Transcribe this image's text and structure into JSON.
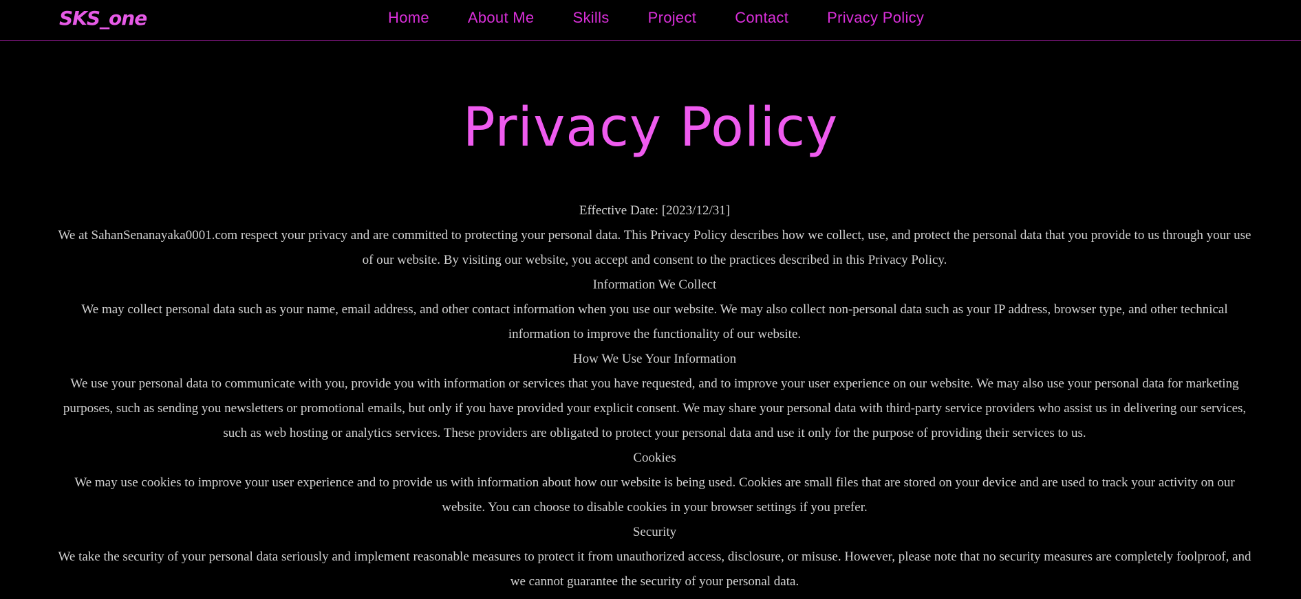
{
  "navbar": {
    "logo": "SKS_one",
    "links": [
      "Home",
      "About Me",
      "Skills",
      "Project",
      "Contact",
      "Privacy Policy"
    ]
  },
  "page_title": "Privacy Policy",
  "policy": {
    "effective_date": "Effective Date: [2023/12/31]",
    "intro": "We at SahanSenanayaka0001.com respect your privacy and are committed to protecting your personal data. This Privacy Policy describes how we collect, use, and protect the personal data that you provide to us through your use of our website. By visiting our website, you accept and consent to the practices described in this Privacy Policy.",
    "sections": [
      {
        "heading": "Information We Collect",
        "body": "We may collect personal data such as your name, email address, and other contact information when you use our website. We may also collect non-personal data such as your IP address, browser type, and other technical information to improve the functionality of our website."
      },
      {
        "heading": "How We Use Your Information",
        "body": "We use your personal data to communicate with you, provide you with information or services that you have requested, and to improve your user experience on our website. We may also use your personal data for marketing purposes, such as sending you newsletters or promotional emails, but only if you have provided your explicit consent. We may share your personal data with third-party service providers who assist us in delivering our services, such as web hosting or analytics services. These providers are obligated to protect your personal data and use it only for the purpose of providing their services to us."
      },
      {
        "heading": "Cookies",
        "body": "We may use cookies to improve your user experience and to provide us with information about how our website is being used. Cookies are small files that are stored on your device and are used to track your activity on our website. You can choose to disable cookies in your browser settings if you prefer."
      },
      {
        "heading": "Security",
        "body": "We take the security of your personal data seriously and implement reasonable measures to protect it from unauthorized access, disclosure, or misuse. However, please note that no security measures are completely foolproof, and we cannot guarantee the security of your personal data."
      }
    ]
  },
  "colors": {
    "background": "#000000",
    "accent": "#e65ae6",
    "nav_text": "#d92fd9",
    "body_text": "#d2d2d2"
  }
}
